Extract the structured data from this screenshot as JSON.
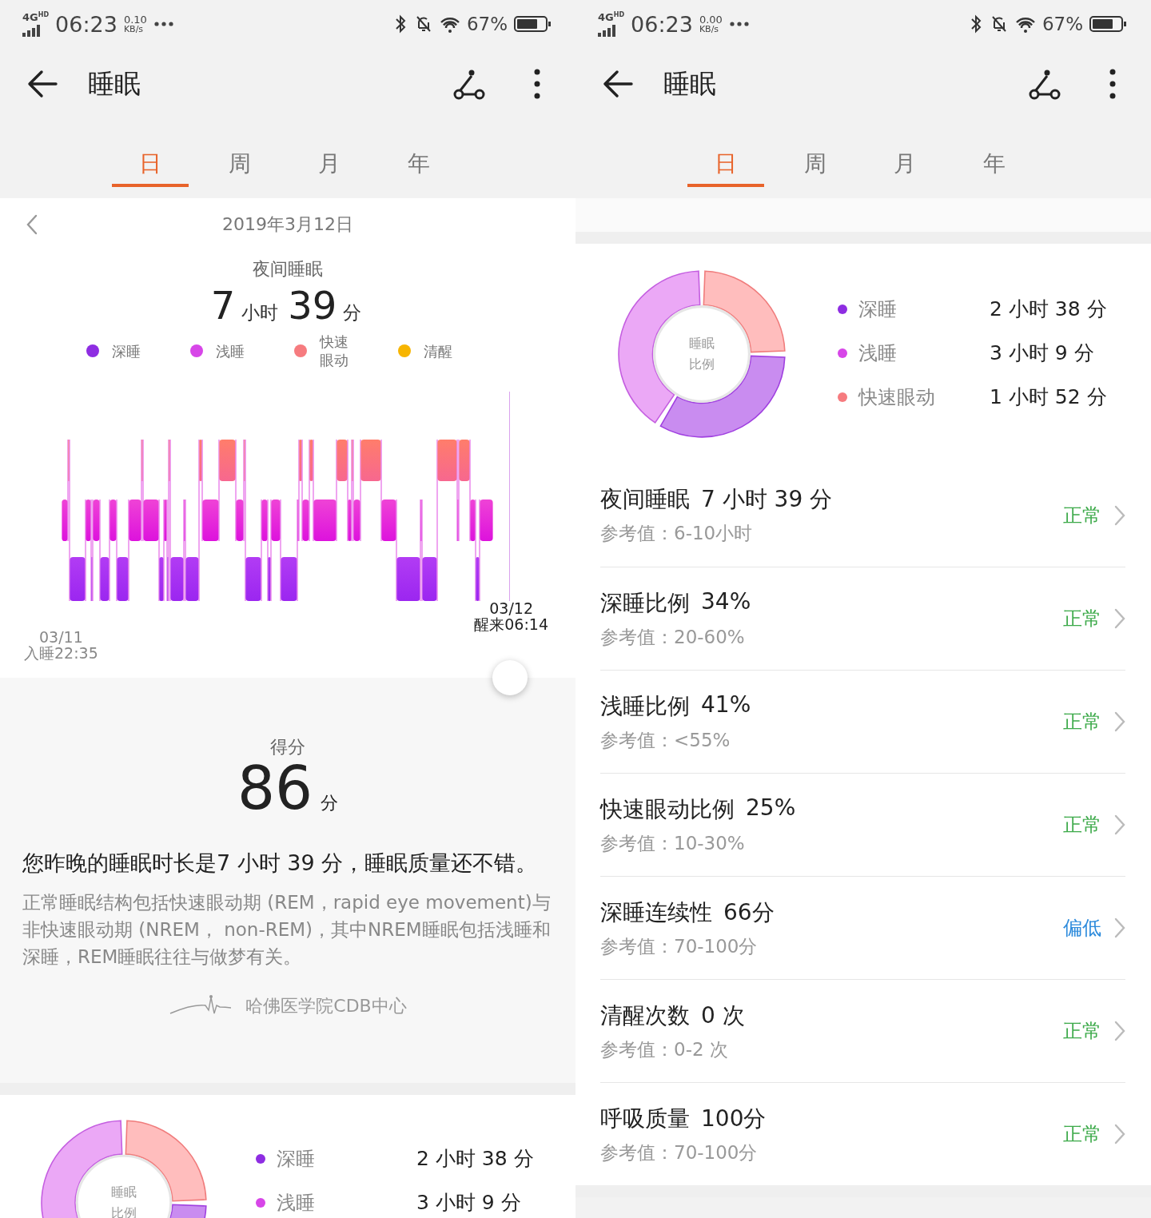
{
  "screens": [
    {
      "status_bar": {
        "network": "4G",
        "network_hd": "HD",
        "time": "06:23",
        "speed": "0.10",
        "speed_unit": "KB/s",
        "battery": "67%"
      },
      "header": {
        "title": "睡眠"
      },
      "tabs": [
        {
          "label": "日",
          "selected": true
        },
        {
          "label": "周",
          "selected": false
        },
        {
          "label": "月",
          "selected": false
        },
        {
          "label": "年",
          "selected": false
        }
      ],
      "day_view": {
        "date": "2019年3月12日",
        "section_title": "夜间睡眠",
        "duration": [
          {
            "text": "7",
            "kind": "number"
          },
          {
            "text": "小时",
            "kind": "unit"
          },
          {
            "text": "39",
            "kind": "number"
          },
          {
            "text": "分",
            "kind": "unit"
          }
        ],
        "legend": [
          {
            "label": "深睡",
            "color": "#8e2de2"
          },
          {
            "label": "浅睡",
            "color": "#d746e8"
          },
          {
            "label": "快速眼动",
            "color": "#f67b7f"
          },
          {
            "label": "清醒",
            "color": "#f7b500"
          }
        ],
        "sleep_start": {
          "date": "03/11",
          "time": "入睡22:35"
        },
        "wake_up": {
          "date": "03/12",
          "time": "醒来06:14"
        }
      },
      "score": {
        "label": "得分",
        "value": "86",
        "unit": "分",
        "summary": "您昨晚的睡眠时长是7 小时 39 分，睡眠质量还不错。",
        "info": "正常睡眠结构包括快速眼动期 (REM，rapid eye movement)与非快速眼动期 (NREM， non-REM)，其中NREM睡眠包括浅睡和深睡，REM睡眠往往与做梦有关。",
        "source": "哈佛医学院CDB中心"
      },
      "ratio": {
        "center_label": [
          "睡眠",
          "比例"
        ],
        "legend": [
          {
            "label": "深睡",
            "color": "#8e2de2",
            "value": "2 小时 38 分"
          },
          {
            "label": "浅睡",
            "color": "#d746e8",
            "value": "3 小时 9 分"
          }
        ]
      }
    },
    {
      "status_bar": {
        "network": "4G",
        "network_hd": "HD",
        "time": "06:23",
        "speed": "0.00",
        "speed_unit": "KB/s",
        "battery": "67%"
      },
      "header": {
        "title": "睡眠"
      },
      "tabs": [
        {
          "label": "日",
          "selected": true
        },
        {
          "label": "周",
          "selected": false
        },
        {
          "label": "月",
          "selected": false
        },
        {
          "label": "年",
          "selected": false
        }
      ],
      "ratio": {
        "center_label": [
          "睡眠",
          "比例"
        ],
        "legend": [
          {
            "label": "深睡",
            "color": "#8e2de2",
            "value": "2 小时 38 分"
          },
          {
            "label": "浅睡",
            "color": "#d746e8",
            "value": "3 小时 9 分"
          },
          {
            "label": "快速眼动",
            "color": "#f67b7f",
            "value": "1 小时 52 分"
          }
        ]
      },
      "metrics": [
        {
          "title": "夜间睡眠",
          "value": "7 小时 39 分",
          "reference": "参考值：6-10小时",
          "status": "正常",
          "kind": "normal"
        },
        {
          "title": "深睡比例",
          "value": "34%",
          "reference": "参考值：20-60%",
          "status": "正常",
          "kind": "normal"
        },
        {
          "title": "浅睡比例",
          "value": "41%",
          "reference": "参考值：<55%",
          "status": "正常",
          "kind": "normal"
        },
        {
          "title": "快速眼动比例",
          "value": "25%",
          "reference": "参考值：10-30%",
          "status": "正常",
          "kind": "normal"
        },
        {
          "title": "深睡连续性",
          "value": "66分",
          "reference": "参考值：70-100分",
          "status": "偏低",
          "kind": "low"
        },
        {
          "title": "清醒次数",
          "value": "0 次",
          "reference": "参考值：0-2 次",
          "status": "正常",
          "kind": "normal"
        },
        {
          "title": "呼吸质量",
          "value": "100分",
          "reference": "参考值：70-100分",
          "status": "正常",
          "kind": "normal"
        }
      ]
    }
  ]
}
